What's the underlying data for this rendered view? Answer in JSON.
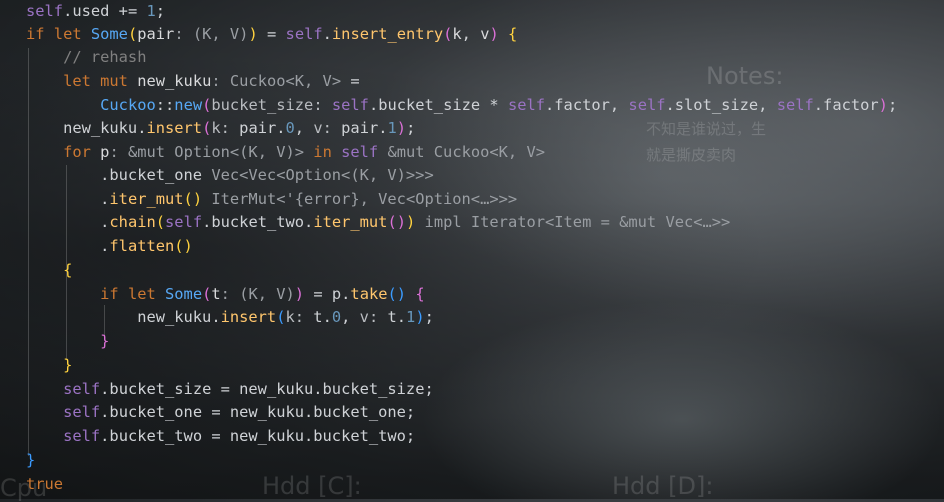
{
  "wallpaper": {
    "notes_title": "Notes:",
    "notes_line1": "不知是谁说过，生",
    "notes_line2": "就是撕皮卖肉",
    "cpu_label": "Cpu",
    "hdd_c_label": "Hdd [C]:",
    "hdd_d_label": "Hdd [D]:"
  },
  "editor": {
    "output_value": "true"
  }
}
